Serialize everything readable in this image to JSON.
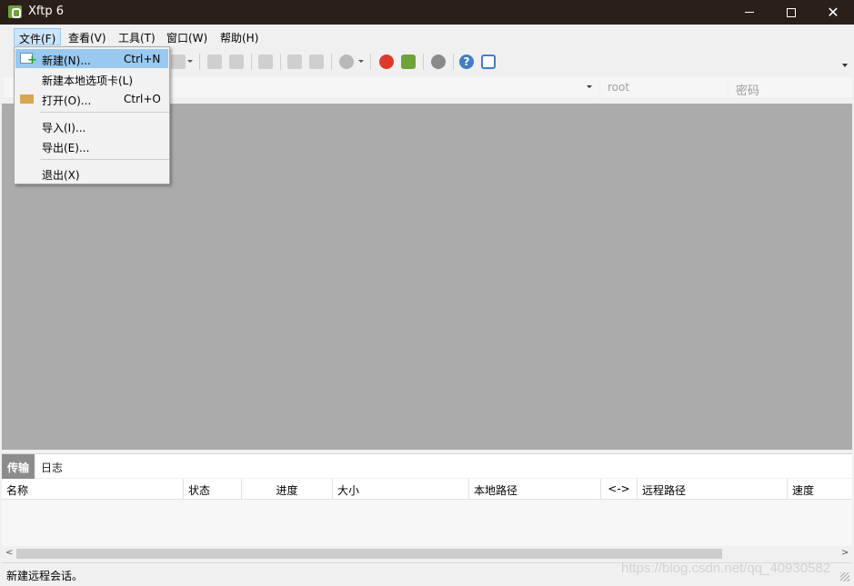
{
  "window": {
    "title": "Xftp 6",
    "controls": [
      "minimize-icon",
      "maximize-icon",
      "close-icon"
    ]
  },
  "menubar": {
    "items": [
      {
        "label": "文件(F)"
      },
      {
        "label": "查看(V)"
      },
      {
        "label": "工具(T)"
      },
      {
        "label": "窗口(W)"
      },
      {
        "label": "帮助(H)"
      }
    ]
  },
  "file_menu": {
    "items": [
      {
        "label": "新建(N)...",
        "shortcut": "Ctrl+N",
        "icon": "new-session-icon",
        "highlighted": true
      },
      {
        "label": "新建本地选项卡(L)",
        "shortcut": ""
      },
      {
        "label": "打开(O)...",
        "shortcut": "Ctrl+O",
        "icon": "open-folder-icon"
      },
      {
        "label": "导入(I)...",
        "shortcut": ""
      },
      {
        "label": "导出(E)...",
        "shortcut": ""
      },
      {
        "label": "退出(X)",
        "shortcut": ""
      }
    ]
  },
  "addressbar": {
    "user_placeholder": "root",
    "password_placeholder": "密码"
  },
  "tabs": [
    {
      "label": "传输",
      "active": true
    },
    {
      "label": "日志",
      "active": false
    }
  ],
  "transfer_table": {
    "columns": [
      "名称",
      "状态",
      "进度",
      "大小",
      "本地路径",
      "<->",
      "远程路径",
      "速度"
    ],
    "rows": []
  },
  "statusbar": {
    "text": "新建远程会话。"
  },
  "watermark": "https://blog.csdn.net/qq_40930582",
  "colors": {
    "titlebar": "#2b1f1a",
    "menu_highlight": "#99c9ef",
    "workspace": "#ababab",
    "active_tab": "#8c8c8c",
    "brand_green": "#6ea33a"
  }
}
